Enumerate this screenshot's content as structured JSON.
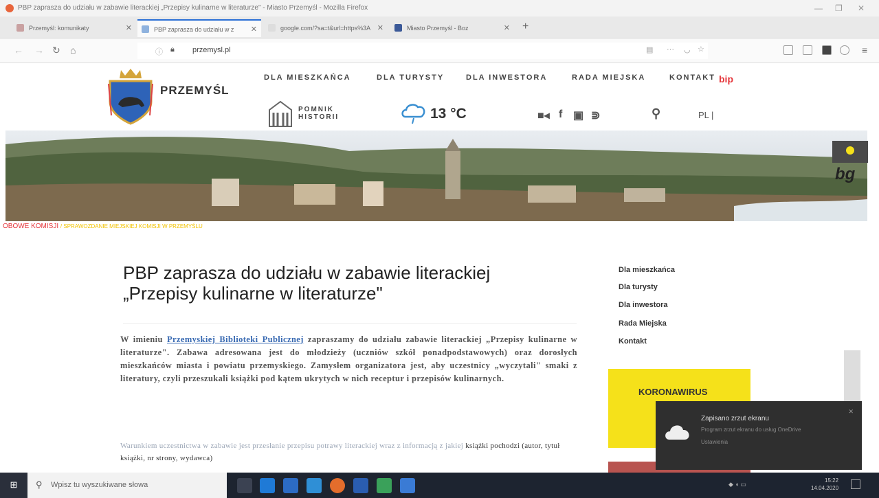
{
  "window": {
    "title": "PBP zaprasza do udziału w zabawie literackiej „Przepisy kulinarne w literaturze\" - Miasto Przemyśl - Mozilla Firefox"
  },
  "tabs": [
    {
      "label": "Przemyśl: komunikaty",
      "active": false
    },
    {
      "label": "PBP zaprasza do udziału w z",
      "active": true
    },
    {
      "label": "google.com/?sa=t&url=https%3A",
      "active": false
    },
    {
      "label": "Miasto Przemyśl - Boz",
      "active": false
    }
  ],
  "url": {
    "domain": "przemysl.pl"
  },
  "site": {
    "brand": "PRZEMYŚL",
    "nav": [
      "DLA MIESZKAŃCA",
      "DLA TURYSTY",
      "DLA INWESTORA",
      "RADA MIEJSKA",
      "KONTAKT"
    ],
    "bip": "bip",
    "monument_line1": "POMNIK",
    "monument_line2": "HISTORII",
    "temperature": "13 °C",
    "lang": "PL |",
    "breadcrumb_red": "OBOWE KOMISJI",
    "breadcrumb_rest": "/ SPRAWOZDANIE MIEJSKIEJ KOMISJI W PRZEMYŚLU",
    "accessibility_label": "bg"
  },
  "article": {
    "title_line1": "PBP zaprasza do udziału w zabawie literackiej",
    "title_line2": "„Przepisy kulinarne w literaturze\"",
    "p1_a": "W imieniu",
    "p1_link": "Przemyskiej Biblioteki Publicznej",
    "p1_b": "zapraszamy do udziału zabawie literackiej „Przepisy kulinarne w literaturze\". Zabawa adresowana jest do młodzieży (uczniów szkół ponadpodstawowych) oraz dorosłych mieszkańców miasta i powiatu przemyskiego. Zamysłem organizatora jest, aby uczestnicy „wyczytali\" smaki z literatury, czyli przeszukali książki pod kątem ukrytych w nich receptur i przepisów kulinarnych.",
    "p2_light": "Warunkiem uczestnictwa w zabawie jest przesłanie przepisu potrawy literackiej wraz z informacją z jakiej",
    "p2_dark": "książki pochodzi (autor, tytuł książki, nr strony, wydawca)"
  },
  "sidebar": {
    "links": [
      "Dla mieszkańca",
      "Dla turysty",
      "Dla inwestora",
      "Rada Miejska",
      "Kontakt"
    ],
    "corona": "KORONAWIRUS"
  },
  "notification": {
    "heading": "Zapisano zrzut ekranu",
    "body": "Program zrzut ekranu do usług OneDrive",
    "link": "Ustawienia",
    "close": "✕"
  },
  "taskbar": {
    "search_placeholder": "Wpisz tu wyszukiwane słowa",
    "start": "⊞",
    "clock_time": "15:22",
    "clock_date": "14.04.2020"
  },
  "colors": {
    "accent_red": "#e5363b",
    "corona_yellow": "#f5e11a",
    "taskbar": "#1d2430"
  }
}
